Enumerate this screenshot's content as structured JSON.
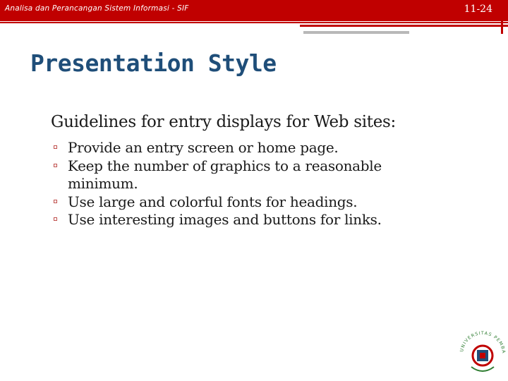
{
  "header": {
    "course": "Analisa dan Perancangan Sistem Informasi - SIF",
    "page_number": "11-24"
  },
  "slide": {
    "title": "Presentation Style",
    "lead": "Guidelines for entry displays for Web sites:",
    "bullets": [
      "Provide an entry screen or home page.",
      "Keep the number of graphics to a reasonable minimum.",
      "Use large and colorful fonts for headings.",
      "Use interesting images and buttons for links."
    ]
  },
  "logo": {
    "text": "UNIVERSITAS PEMBANGUNAN JAYA"
  },
  "colors": {
    "header": "#c00000",
    "title": "#1f4e79",
    "bullet_marker": "#c0504d"
  }
}
